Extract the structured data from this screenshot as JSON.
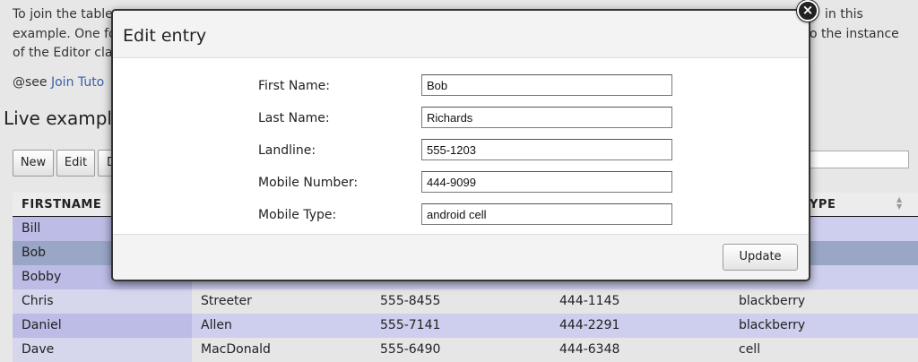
{
  "background": {
    "intro_lines": [
      "To join the table",
      "example. One fo",
      "of the Editor cla"
    ],
    "intro_right_lines": [
      "in this",
      "o the instance"
    ],
    "see_prefix": "@see",
    "see_link": "Join Tuto",
    "live_title": "Live example"
  },
  "toolbar": {
    "new_label": "New",
    "edit_label": "Edit",
    "delete_label": "D"
  },
  "table": {
    "headers": {
      "firstname": "FIRSTNAME",
      "mobile_type": "YPE"
    },
    "rows": [
      {
        "first": "Bill",
        "last": "",
        "landline": "",
        "mobile": "",
        "type": ""
      },
      {
        "first": "Bob",
        "last": "",
        "landline": "",
        "mobile": "",
        "type": ""
      },
      {
        "first": "Bobby",
        "last": "",
        "landline": "",
        "mobile": "",
        "type": ""
      },
      {
        "first": "Chris",
        "last": "Streeter",
        "landline": "555-8455",
        "mobile": "444-1145",
        "type": "blackberry"
      },
      {
        "first": "Daniel",
        "last": "Allen",
        "landline": "555-7141",
        "mobile": "444-2291",
        "type": "blackberry"
      },
      {
        "first": "Dave",
        "last": "MacDonald",
        "landline": "555-6490",
        "mobile": "444-6348",
        "type": "cell"
      }
    ]
  },
  "modal": {
    "title": "Edit entry",
    "close_glyph": "×",
    "fields": [
      {
        "label": "First Name:",
        "value": "Bob"
      },
      {
        "label": "Last Name:",
        "value": "Richards"
      },
      {
        "label": "Landline:",
        "value": "555-1203"
      },
      {
        "label": "Mobile Number:",
        "value": "444-9099"
      },
      {
        "label": "Mobile Type:",
        "value": "android cell"
      }
    ],
    "update_label": "Update"
  },
  "colors": {
    "row_odd_first": "#bcbce6",
    "row_even_first": "#d6d6ec",
    "row_odd": "#ceceee",
    "row_even": "#e6e6e6",
    "row_selected": "#9aa6c6",
    "link": "#3a5ea8"
  }
}
